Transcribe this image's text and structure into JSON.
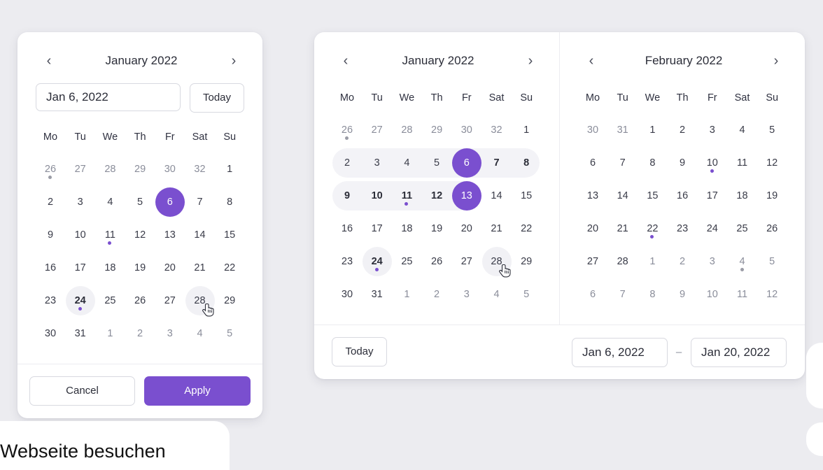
{
  "single": {
    "month_title": "January 2022",
    "prev_icon": "chevron-left-icon",
    "next_icon": "chevron-right-icon",
    "date_value": "Jan 6, 2022",
    "today_label": "Today",
    "weekdays": [
      "Mo",
      "Tu",
      "We",
      "Th",
      "Fr",
      "Sat",
      "Su"
    ],
    "weeks": [
      [
        {
          "d": "26",
          "o": true,
          "dot": "gray"
        },
        {
          "d": "27",
          "o": true
        },
        {
          "d": "28",
          "o": true
        },
        {
          "d": "29",
          "o": true
        },
        {
          "d": "30",
          "o": true
        },
        {
          "d": "32",
          "o": true
        },
        {
          "d": "1"
        }
      ],
      [
        {
          "d": "2"
        },
        {
          "d": "3"
        },
        {
          "d": "4"
        },
        {
          "d": "5"
        },
        {
          "d": "6",
          "sel": true
        },
        {
          "d": "7"
        },
        {
          "d": "8"
        }
      ],
      [
        {
          "d": "9"
        },
        {
          "d": "10"
        },
        {
          "d": "11",
          "dot": "purple"
        },
        {
          "d": "12"
        },
        {
          "d": "13"
        },
        {
          "d": "14"
        },
        {
          "d": "15"
        }
      ],
      [
        {
          "d": "16"
        },
        {
          "d": "17"
        },
        {
          "d": "18"
        },
        {
          "d": "19"
        },
        {
          "d": "20"
        },
        {
          "d": "21"
        },
        {
          "d": "22"
        }
      ],
      [
        {
          "d": "23"
        },
        {
          "d": "24",
          "hover": true,
          "bold": true,
          "dot": "purple"
        },
        {
          "d": "25"
        },
        {
          "d": "26"
        },
        {
          "d": "27"
        },
        {
          "d": "28",
          "hover": true,
          "cursor": true
        },
        {
          "d": "29"
        }
      ],
      [
        {
          "d": "30"
        },
        {
          "d": "31"
        },
        {
          "d": "1",
          "o": true
        },
        {
          "d": "2",
          "o": true
        },
        {
          "d": "3",
          "o": true
        },
        {
          "d": "4",
          "o": true
        },
        {
          "d": "5",
          "o": true
        }
      ]
    ],
    "cancel_label": "Cancel",
    "apply_label": "Apply"
  },
  "range": {
    "left_month_title": "January 2022",
    "right_month_title": "February 2022",
    "weekdays": [
      "Mo",
      "Tu",
      "We",
      "Th",
      "Fr",
      "Sat",
      "Su"
    ],
    "left_weeks": [
      [
        {
          "d": "26",
          "o": true,
          "dot": "gray"
        },
        {
          "d": "27",
          "o": true
        },
        {
          "d": "28",
          "o": true
        },
        {
          "d": "29",
          "o": true
        },
        {
          "d": "30",
          "o": true
        },
        {
          "d": "32",
          "o": true
        },
        {
          "d": "1"
        }
      ],
      [
        {
          "d": "2"
        },
        {
          "d": "3"
        },
        {
          "d": "4"
        },
        {
          "d": "5"
        },
        {
          "d": "6",
          "sel": true
        },
        {
          "d": "7",
          "bold": true
        },
        {
          "d": "8",
          "bold": true
        }
      ],
      [
        {
          "d": "9",
          "bold": true
        },
        {
          "d": "10",
          "bold": true
        },
        {
          "d": "11",
          "bold": true,
          "dot": "purple"
        },
        {
          "d": "12",
          "bold": true
        },
        {
          "d": "13",
          "sel": true
        },
        {
          "d": "14"
        },
        {
          "d": "15"
        }
      ],
      [
        {
          "d": "16"
        },
        {
          "d": "17"
        },
        {
          "d": "18"
        },
        {
          "d": "19"
        },
        {
          "d": "20"
        },
        {
          "d": "21"
        },
        {
          "d": "22"
        }
      ],
      [
        {
          "d": "23"
        },
        {
          "d": "24",
          "hover": true,
          "bold": true,
          "dot": "purple"
        },
        {
          "d": "25"
        },
        {
          "d": "26"
        },
        {
          "d": "27"
        },
        {
          "d": "28",
          "hover": true,
          "cursor": true
        },
        {
          "d": "29"
        }
      ],
      [
        {
          "d": "30"
        },
        {
          "d": "31"
        },
        {
          "d": "1",
          "o": true
        },
        {
          "d": "2",
          "o": true
        },
        {
          "d": "3",
          "o": true
        },
        {
          "d": "4",
          "o": true
        },
        {
          "d": "5",
          "o": true
        }
      ]
    ],
    "right_weeks": [
      [
        {
          "d": "30",
          "o": true
        },
        {
          "d": "31",
          "o": true
        },
        {
          "d": "1"
        },
        {
          "d": "2"
        },
        {
          "d": "3"
        },
        {
          "d": "4"
        },
        {
          "d": "5"
        }
      ],
      [
        {
          "d": "6"
        },
        {
          "d": "7"
        },
        {
          "d": "8"
        },
        {
          "d": "9"
        },
        {
          "d": "10",
          "dot": "purple"
        },
        {
          "d": "11"
        },
        {
          "d": "12"
        }
      ],
      [
        {
          "d": "13"
        },
        {
          "d": "14"
        },
        {
          "d": "15"
        },
        {
          "d": "16"
        },
        {
          "d": "17"
        },
        {
          "d": "18"
        },
        {
          "d": "19"
        }
      ],
      [
        {
          "d": "20"
        },
        {
          "d": "21"
        },
        {
          "d": "22",
          "dot": "purple"
        },
        {
          "d": "23"
        },
        {
          "d": "24"
        },
        {
          "d": "25"
        },
        {
          "d": "26"
        }
      ],
      [
        {
          "d": "27"
        },
        {
          "d": "28"
        },
        {
          "d": "1",
          "o": true
        },
        {
          "d": "2",
          "o": true
        },
        {
          "d": "3",
          "o": true
        },
        {
          "d": "4",
          "o": true,
          "dot": "gray"
        },
        {
          "d": "5",
          "o": true
        }
      ],
      [
        {
          "d": "6",
          "o": true
        },
        {
          "d": "7",
          "o": true
        },
        {
          "d": "8",
          "o": true
        },
        {
          "d": "9",
          "o": true
        },
        {
          "d": "10",
          "o": true
        },
        {
          "d": "11",
          "o": true
        },
        {
          "d": "12",
          "o": true
        }
      ]
    ],
    "today_label": "Today",
    "start_value": "Jan 6, 2022",
    "separator": "–",
    "end_value": "Jan 20, 2022"
  },
  "footer": {
    "visit_label": "Webseite besuchen"
  },
  "colors": {
    "accent": "#7a4fcf",
    "background": "#ececf0",
    "range_band": "#f3f3f7"
  }
}
